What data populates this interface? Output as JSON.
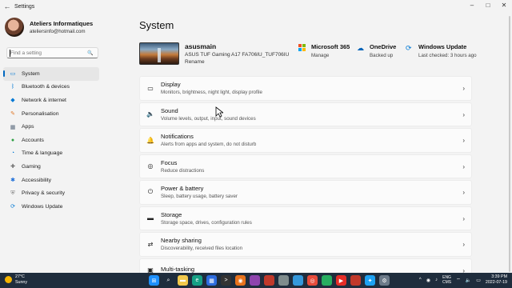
{
  "window": {
    "title": "Settings",
    "back_icon": "back-arrow-icon",
    "controls": {
      "minimize": "–",
      "maximize": "□",
      "close": "✕"
    }
  },
  "user": {
    "name": "Ateliers Informatiques",
    "email": "ateliersinfo@hotmail.com"
  },
  "search": {
    "placeholder": "Find a setting",
    "icon": "search-icon"
  },
  "sidebar": {
    "items": [
      {
        "label": "System",
        "icon": "system-icon",
        "color": "#0078d4",
        "active": true
      },
      {
        "label": "Bluetooth & devices",
        "icon": "bluetooth-icon",
        "color": "#0078d4"
      },
      {
        "label": "Network & internet",
        "icon": "wifi-icon",
        "color": "#0078d4"
      },
      {
        "label": "Personalisation",
        "icon": "brush-icon",
        "color": "#e07a2c"
      },
      {
        "label": "Apps",
        "icon": "apps-icon",
        "color": "#5a6b7d"
      },
      {
        "label": "Accounts",
        "icon": "person-icon",
        "color": "#2ea043"
      },
      {
        "label": "Time & language",
        "icon": "globe-clock-icon",
        "color": "#0078d4"
      },
      {
        "label": "Gaming",
        "icon": "gamepad-icon",
        "color": "#6b6b6b"
      },
      {
        "label": "Accessibility",
        "icon": "accessibility-icon",
        "color": "#1e6fd9"
      },
      {
        "label": "Privacy & security",
        "icon": "shield-icon",
        "color": "#7a7a7a"
      },
      {
        "label": "Windows Update",
        "icon": "windows-update-icon",
        "color": "#0078d4"
      }
    ]
  },
  "main": {
    "title": "System",
    "device": {
      "name": "asusmain",
      "model": "ASUS TUF Gaming A17 FA706IU_TUF706IU",
      "rename": "Rename"
    },
    "tiles": [
      {
        "title": "Microsoft 365",
        "sub": "Manage",
        "icon": "microsoft-365-icon"
      },
      {
        "title": "OneDrive",
        "sub": "Backed up",
        "icon": "onedrive-icon"
      },
      {
        "title": "Windows Update",
        "sub": "Last checked: 3 hours ago",
        "icon": "windows-update-icon"
      }
    ],
    "cards": [
      {
        "title": "Display",
        "sub": "Monitors, brightness, night light, display profile",
        "icon": "display-icon"
      },
      {
        "title": "Sound",
        "sub": "Volume levels, output, input, sound devices",
        "icon": "speaker-icon"
      },
      {
        "title": "Notifications",
        "sub": "Alerts from apps and system, do not disturb",
        "icon": "bell-icon"
      },
      {
        "title": "Focus",
        "sub": "Reduce distractions",
        "icon": "focus-icon"
      },
      {
        "title": "Power & battery",
        "sub": "Sleep, battery usage, battery saver",
        "icon": "power-icon"
      },
      {
        "title": "Storage",
        "sub": "Storage space, drives, configuration rules",
        "icon": "storage-icon"
      },
      {
        "title": "Nearby sharing",
        "sub": "Discoverability, received files location",
        "icon": "share-icon"
      },
      {
        "title": "Multi-tasking",
        "sub": "",
        "icon": "multitasking-icon"
      }
    ]
  },
  "taskbar": {
    "weather": {
      "temp": "27°C",
      "condition": "Sunny"
    },
    "apps": [
      {
        "name": "start-icon",
        "color": "#1e90ff"
      },
      {
        "name": "search-icon",
        "color": "#1f2d3d"
      },
      {
        "name": "file-explorer-icon",
        "color": "#f2c94c"
      },
      {
        "name": "edge-icon",
        "color": "#16a085"
      },
      {
        "name": "store-icon",
        "color": "#2d6cdf"
      },
      {
        "name": "terminal-icon",
        "color": "#333333"
      },
      {
        "name": "firefox-icon",
        "color": "#e8731d"
      },
      {
        "name": "app-icon",
        "color": "#8e44ad"
      },
      {
        "name": "app-icon",
        "color": "#c0392b"
      },
      {
        "name": "app-icon",
        "color": "#7f8c8d"
      },
      {
        "name": "app-icon",
        "color": "#3498db"
      },
      {
        "name": "chrome-icon",
        "color": "#e74c3c"
      },
      {
        "name": "app-icon",
        "color": "#27ae60"
      },
      {
        "name": "youtube-icon",
        "color": "#e52d27"
      },
      {
        "name": "app-icon",
        "color": "#c0392b"
      },
      {
        "name": "twitter-icon",
        "color": "#1da1f2"
      },
      {
        "name": "settings-icon",
        "color": "#6c7a89"
      }
    ],
    "tray": {
      "lang_top": "ENG",
      "lang_bottom": "CMS",
      "time": "3:39 PM",
      "date": "2022-07-19"
    }
  }
}
